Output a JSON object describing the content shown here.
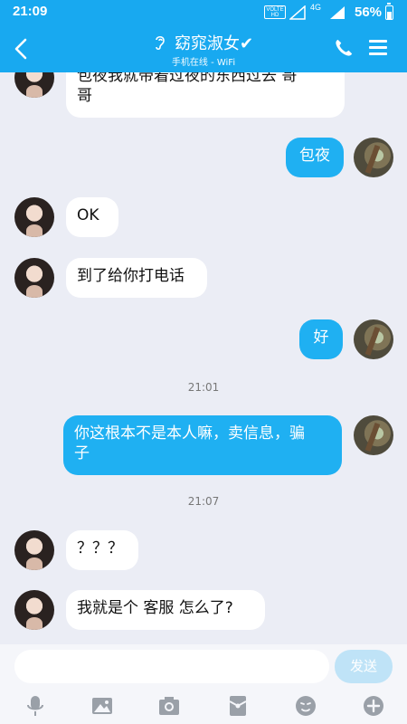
{
  "status_bar": {
    "time": "21:09",
    "volte": "VOLTE\nHD",
    "network": "4G",
    "battery": "56%"
  },
  "header": {
    "contact_name": "窈窕淑女✔",
    "status": "手机在线 - WiFi"
  },
  "messages": [
    {
      "side": "in",
      "text": "包夜我就带着过夜的东西过去 哥\n哥"
    },
    {
      "side": "out",
      "text": "包夜"
    },
    {
      "side": "in",
      "text": "OK"
    },
    {
      "side": "in",
      "text": "到了给你打电话"
    },
    {
      "side": "out",
      "text": "好"
    },
    {
      "side": "time",
      "text": "21:01"
    },
    {
      "side": "out",
      "text": "你这根本不是本人嘛，卖信息，骗\n子"
    },
    {
      "side": "time",
      "text": "21:07"
    },
    {
      "side": "in",
      "text": "？？？"
    },
    {
      "side": "in",
      "text": "我就是个 客服 怎么了?"
    }
  ],
  "input": {
    "value": "",
    "placeholder": "",
    "send_label": "发送"
  },
  "toolbar": {
    "icons": [
      "microphone-icon",
      "image-icon",
      "camera-icon",
      "red-packet-icon",
      "emoji-icon",
      "plus-icon"
    ]
  },
  "colors": {
    "header": "#18a9f0",
    "outgoing_bubble": "#1fb0f2",
    "background": "#ebedf5",
    "send_disabled": "#bfe3f7"
  }
}
